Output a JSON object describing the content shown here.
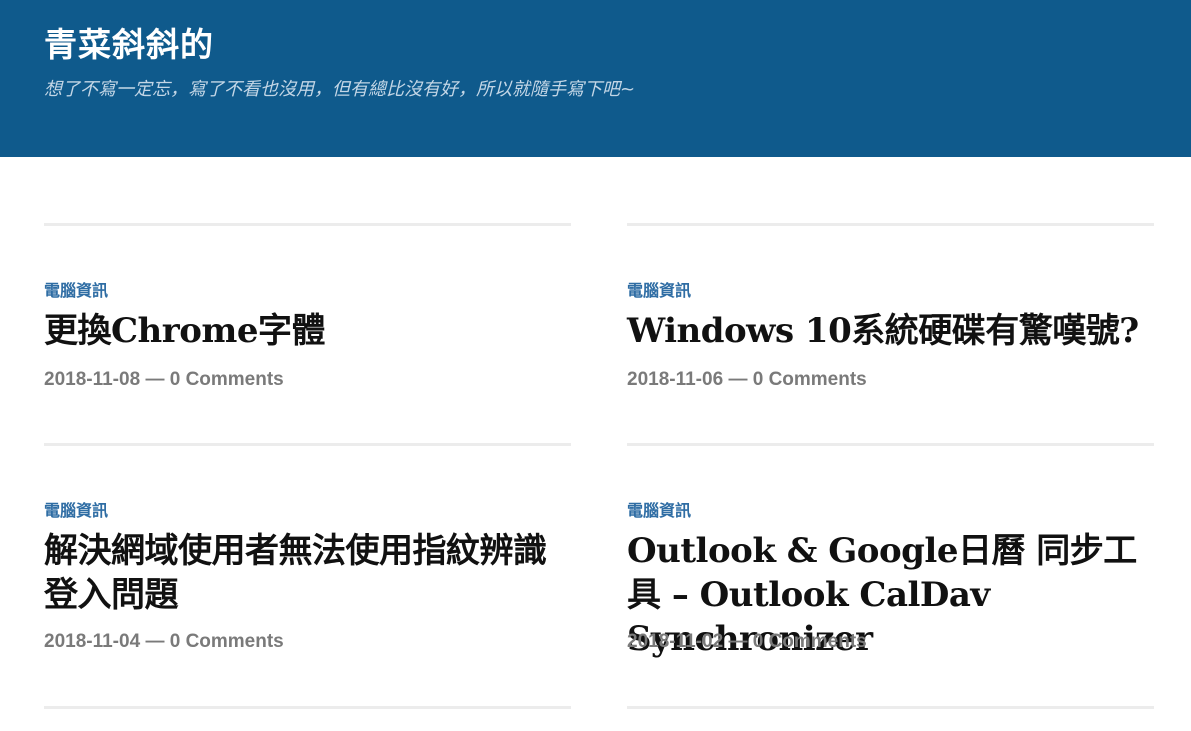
{
  "site": {
    "title": "青菜斜斜的",
    "description": "想了不寫一定忘，寫了不看也沒用，但有總比沒有好，所以就隨手寫下吧~"
  },
  "posts": [
    {
      "category": "電腦資訊",
      "title": "更換Chrome字體",
      "date": "2018-11-08",
      "separator": "—",
      "comments": "0 Comments"
    },
    {
      "category": "電腦資訊",
      "title": "Windows 10系統硬碟有驚嘆號?",
      "date": "2018-11-06",
      "separator": "—",
      "comments": "0 Comments"
    },
    {
      "category": "電腦資訊",
      "title": "解決網域使用者無法使用指紋辨識登入問題",
      "date": "2018-11-04",
      "separator": "—",
      "comments": "0 Comments"
    },
    {
      "category": "電腦資訊",
      "title": "Outlook & Google日曆 同步工具 – Outlook CalDav Synchronizer",
      "date": "2018-11-02",
      "separator": "—",
      "comments": "0 Comments"
    }
  ]
}
